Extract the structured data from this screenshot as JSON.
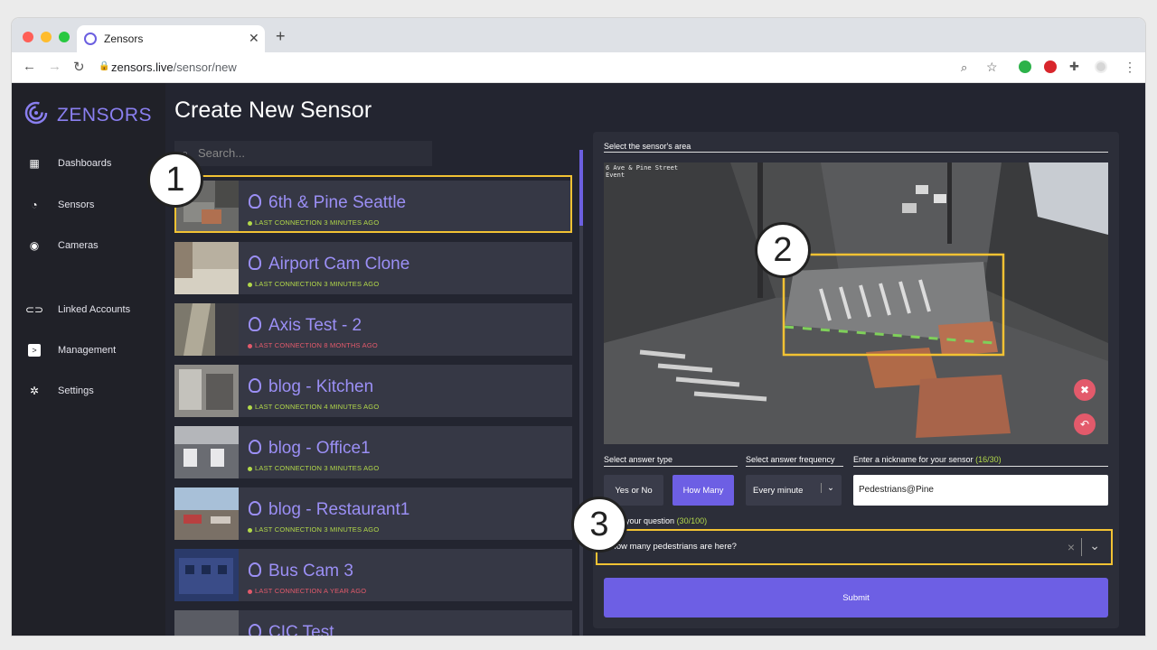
{
  "browser": {
    "tab_title": "Zensors",
    "new_tab": "+",
    "close_tab": "✕",
    "url_host": "zensors.live",
    "url_path": "/sensor/new"
  },
  "app": {
    "brand": "ZENSORS",
    "title": "Create New Sensor",
    "nav": [
      {
        "label": "Dashboards",
        "icon": "dashboard-icon"
      },
      {
        "label": "Sensors",
        "icon": "sensor-icon"
      },
      {
        "label": "Cameras",
        "icon": "camera-icon"
      },
      {
        "label": "Linked Accounts",
        "icon": "link-icon"
      },
      {
        "label": "Management",
        "icon": "terminal-icon"
      },
      {
        "label": "Settings",
        "icon": "gear-icon"
      }
    ],
    "search_placeholder": "Search...",
    "sensors": [
      {
        "name": "6th & Pine Seattle",
        "status": "LAST CONNECTION 3 MINUTES AGO",
        "ok": true
      },
      {
        "name": "Airport Cam Clone",
        "status": "LAST CONNECTION 3 MINUTES AGO",
        "ok": true
      },
      {
        "name": "Axis Test - 2",
        "status": "LAST CONNECTION 8 MONTHS AGO",
        "ok": false
      },
      {
        "name": "blog - Kitchen",
        "status": "LAST CONNECTION 4 MINUTES AGO",
        "ok": true
      },
      {
        "name": "blog - Office1",
        "status": "LAST CONNECTION 3 MINUTES AGO",
        "ok": true
      },
      {
        "name": "blog - Restaurant1",
        "status": "LAST CONNECTION 3 MINUTES AGO",
        "ok": true
      },
      {
        "name": "Bus Cam 3",
        "status": "LAST CONNECTION A YEAR AGO",
        "ok": false
      },
      {
        "name": "CIC Test",
        "status": "",
        "ok": true
      }
    ]
  },
  "panel": {
    "area_label": "Select the sensor's area",
    "camera_overlay": "6 Ave & Pine Street\nEvent",
    "answer_type_label": "Select answer type",
    "answer_types": [
      "Yes or No",
      "How Many"
    ],
    "selected_answer_type": "How Many",
    "frequency_label": "Select answer frequency",
    "frequency_value": "Every minute",
    "nickname_label": "Enter a nickname for your sensor",
    "nickname_count": "(16/30)",
    "nickname_value": "Pedestrians@Pine",
    "question_label": "your question",
    "question_count": "(30/100)",
    "question_value": "How many pedestrians are here?",
    "clear_glyph": "×",
    "submit_label": "Submit"
  },
  "callouts": [
    "1",
    "2",
    "3"
  ],
  "colors": {
    "accent": "#6d5fe4",
    "highlight": "#f2c233",
    "ok_status": "#b3d94a",
    "error_status": "#e35a6b"
  }
}
